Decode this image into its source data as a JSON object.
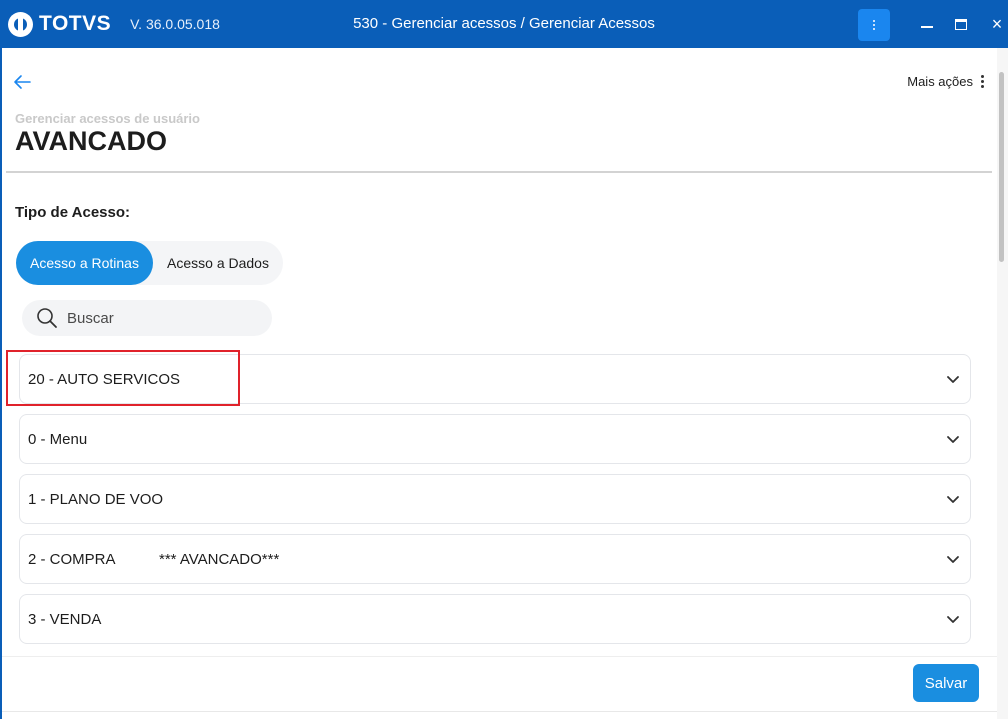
{
  "titlebar": {
    "brand": "TOTVS",
    "version": "V. 36.0.05.018",
    "title": "530 - Gerenciar acessos / Gerenciar Acessos",
    "close_glyph": "×"
  },
  "header": {
    "more_actions_label": "Mais ações",
    "subtitle": "Gerenciar acessos de usuário",
    "title": "AVANCADO"
  },
  "access_type": {
    "label": "Tipo de Acesso:",
    "tabs": [
      {
        "label": "Acesso a Rotinas",
        "active": true
      },
      {
        "label": "Acesso a Dados",
        "active": false
      }
    ]
  },
  "search": {
    "placeholder": "Buscar",
    "value": ""
  },
  "modules": [
    {
      "label": "20 - AUTO SERVICOS",
      "extra": ""
    },
    {
      "label": "0 - Menu",
      "extra": ""
    },
    {
      "label": "1 - PLANO DE VOO",
      "extra": ""
    },
    {
      "label": "2 - COMPRA",
      "extra": "*** AVANCADO***"
    },
    {
      "label": "3 - VENDA",
      "extra": ""
    }
  ],
  "footer": {
    "save_label": "Salvar"
  },
  "colors": {
    "titlebar": "#0a5eb8",
    "accent": "#1a8ee0",
    "highlight": "#e0222b"
  },
  "icons": [
    "back-arrow-icon",
    "more-vert-icon",
    "search-icon",
    "chevron-down-icon",
    "minimize-icon",
    "maximize-icon",
    "close-icon"
  ]
}
